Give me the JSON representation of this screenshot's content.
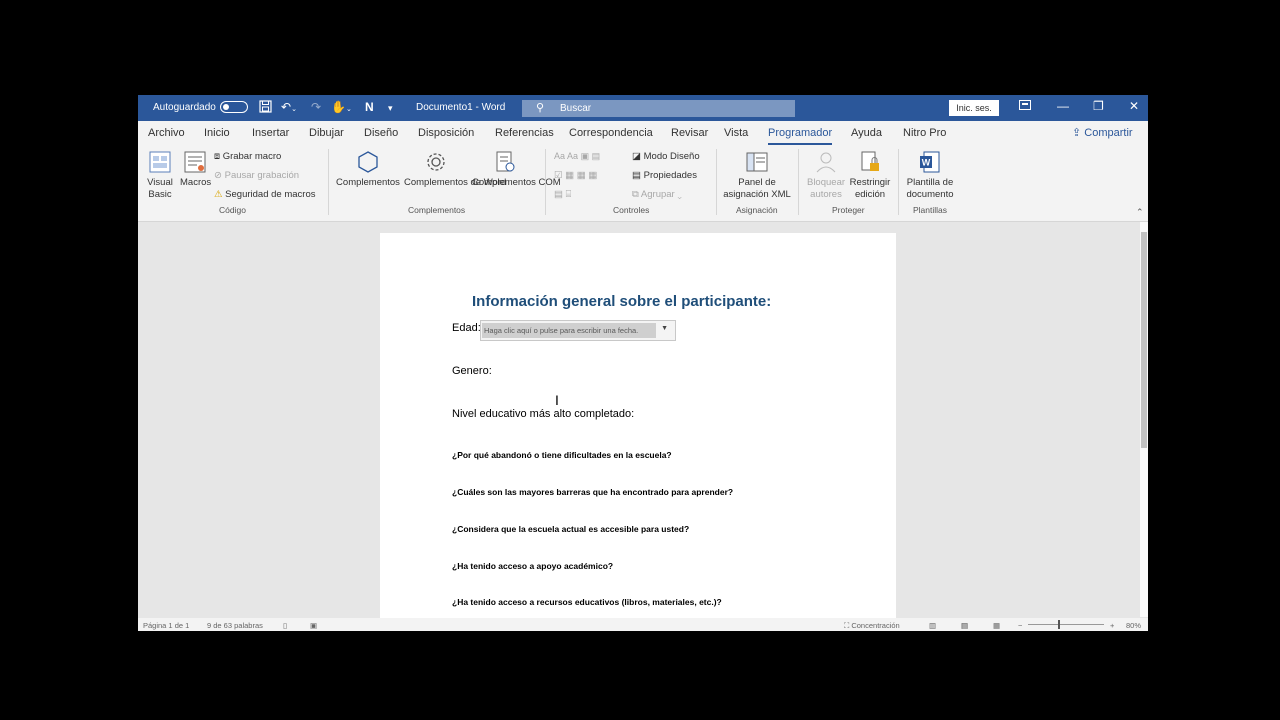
{
  "titlebar": {
    "autosave_label": "Autoguardado",
    "doc_title": "Documento1",
    "separator": "-",
    "app_name": "Word",
    "search_placeholder": "Buscar",
    "signin_label": "Inic. ses.",
    "color": "#2b579a"
  },
  "tabs": [
    {
      "label": "Archivo"
    },
    {
      "label": "Inicio"
    },
    {
      "label": "Insertar"
    },
    {
      "label": "Dibujar"
    },
    {
      "label": "Diseño"
    },
    {
      "label": "Disposición"
    },
    {
      "label": "Referencias"
    },
    {
      "label": "Correspondencia"
    },
    {
      "label": "Revisar"
    },
    {
      "label": "Vista"
    },
    {
      "label": "Programador",
      "active": true
    },
    {
      "label": "Ayuda"
    },
    {
      "label": "Nitro Pro"
    }
  ],
  "share_label": "Compartir",
  "ribbon": {
    "codigo": {
      "visual_basic": "Visual Basic",
      "macros": "Macros",
      "record_macro": "Grabar macro",
      "pause_recording": "Pausar grabación",
      "macro_security": "Seguridad de macros",
      "group": "Código"
    },
    "complementos": {
      "addins": "Complementos",
      "word_addins": "Complementos de Word",
      "com_addins": "Complementos COM",
      "group": "Complementos"
    },
    "controles": {
      "design_mode": "Modo Diseño",
      "properties": "Propiedades",
      "group_ctrl": "Agrupar",
      "group": "Controles"
    },
    "asignacion": {
      "xml_pane": "Panel de asignación XML",
      "group": "Asignación"
    },
    "proteger": {
      "block_authors": "Bloquear autores",
      "restrict_editing": "Restringir edición",
      "group": "Proteger"
    },
    "plantillas": {
      "template": "Plantilla de documento",
      "group": "Plantillas"
    }
  },
  "document": {
    "heading": "Información general sobre el participante:",
    "age_label": "Edad:",
    "date_placeholder": "Haga clic aquí o pulse para escribir una fecha.",
    "gender_label": "Genero:",
    "education_label": "Nivel educativo más alto completado:",
    "questions": [
      "¿Por qué abandonó o tiene dificultades en la escuela?",
      "¿Cuáles son las mayores barreras que ha encontrado para aprender?",
      "¿Considera que la escuela actual es accesible para usted?",
      "¿Ha tenido acceso a apoyo académico?",
      "¿Ha tenido acceso a recursos educativos (libros, materiales, etc.)?"
    ]
  },
  "status": {
    "page": "Página 1 de 1",
    "words": "9 de 63 palabras",
    "focus": "Concentración",
    "zoom": "80%"
  }
}
